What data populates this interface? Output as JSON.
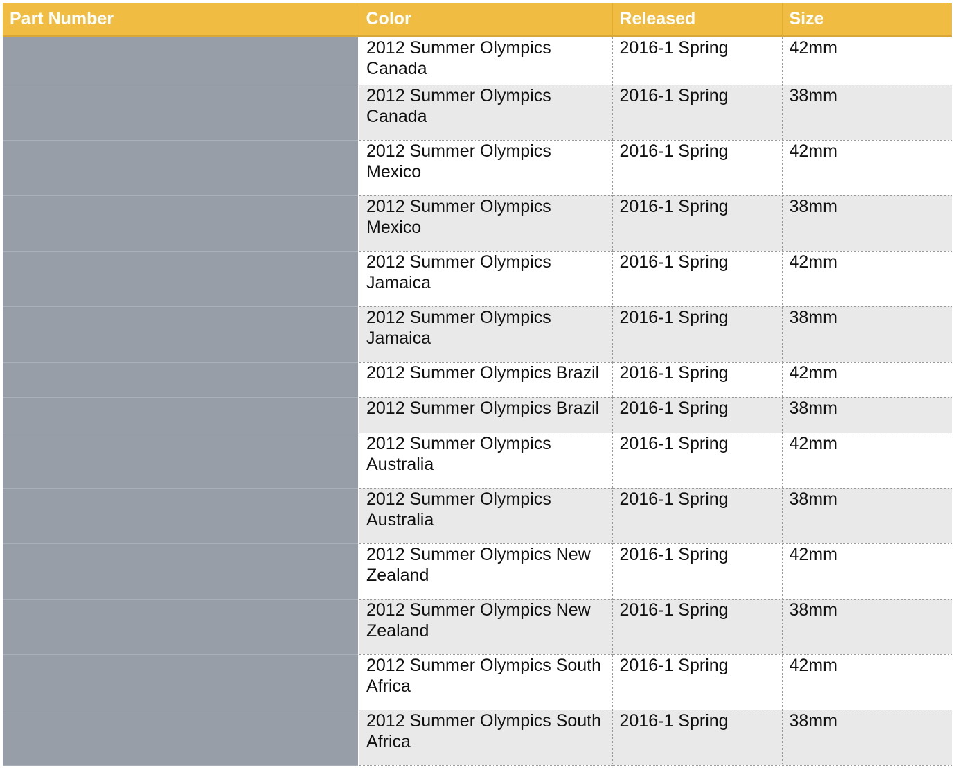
{
  "chart_data": {
    "type": "table",
    "columns": [
      "Part Number",
      "Color",
      "Released",
      "Size"
    ],
    "rows": [
      {
        "part_number": "",
        "color": "2012 Summer Olympics Canada",
        "released": "2016-1 Spring",
        "size": "42mm"
      },
      {
        "part_number": "",
        "color": "2012 Summer Olympics Canada",
        "released": "2016-1 Spring",
        "size": "38mm"
      },
      {
        "part_number": "",
        "color": "2012 Summer Olympics Mexico",
        "released": "2016-1 Spring",
        "size": "42mm"
      },
      {
        "part_number": "",
        "color": "2012 Summer Olympics Mexico",
        "released": "2016-1 Spring",
        "size": "38mm"
      },
      {
        "part_number": "",
        "color": "2012 Summer Olympics Jamaica",
        "released": "2016-1 Spring",
        "size": "42mm"
      },
      {
        "part_number": "",
        "color": "2012 Summer Olympics Jamaica",
        "released": "2016-1 Spring",
        "size": "38mm"
      },
      {
        "part_number": "",
        "color": "2012 Summer Olympics Brazil",
        "released": "2016-1 Spring",
        "size": "42mm"
      },
      {
        "part_number": "",
        "color": "2012 Summer Olympics Brazil",
        "released": "2016-1 Spring",
        "size": "38mm"
      },
      {
        "part_number": "",
        "color": "2012 Summer Olympics Australia",
        "released": "2016-1 Spring",
        "size": "42mm"
      },
      {
        "part_number": "",
        "color": "2012 Summer Olympics Australia",
        "released": "2016-1 Spring",
        "size": "38mm"
      },
      {
        "part_number": "",
        "color": "2012 Summer Olympics New Zealand",
        "released": "2016-1 Spring",
        "size": "42mm"
      },
      {
        "part_number": "",
        "color": "2012 Summer Olympics New Zealand",
        "released": "2016-1 Spring",
        "size": "38mm"
      },
      {
        "part_number": "",
        "color": "2012 Summer Olympics South Africa",
        "released": "2016-1 Spring",
        "size": "42mm"
      },
      {
        "part_number": "",
        "color": "2012 Summer Olympics South Africa",
        "released": "2016-1 Spring",
        "size": "38mm"
      }
    ]
  },
  "colors": {
    "header_background": "#f0bc42",
    "header_text": "#ffffff",
    "part_number_fill": "#979ea8",
    "row_alternate": "#e9e9e9"
  }
}
